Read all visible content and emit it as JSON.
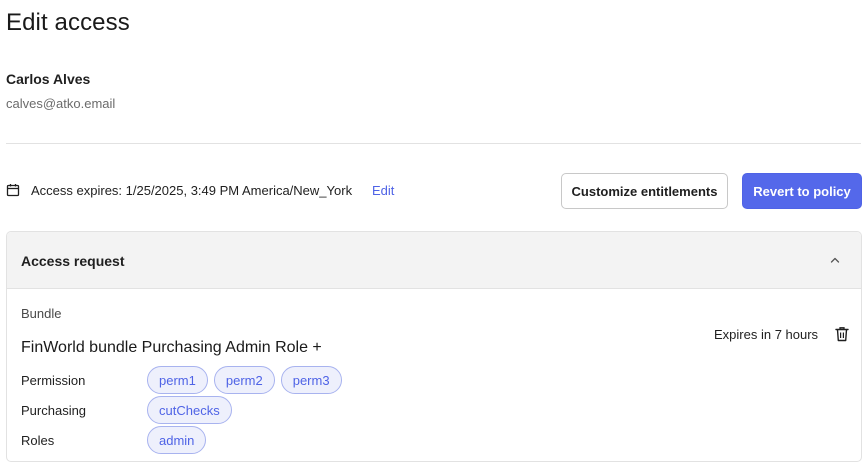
{
  "page": {
    "title": "Edit access"
  },
  "user": {
    "name": "Carlos Alves",
    "email": "calves@atko.email"
  },
  "access": {
    "expires_text": "Access expires: 1/25/2025, 3:49 PM America/New_York",
    "edit_label": "Edit"
  },
  "actions": {
    "customize_label": "Customize entitlements",
    "revert_label": "Revert to policy"
  },
  "request": {
    "title": "Access request",
    "section_label": "Bundle",
    "bundle_name": "FinWorld bundle Purchasing Admin Role +",
    "expires_label": "Expires in 7 hours",
    "rows": [
      {
        "label": "Permission",
        "tags": [
          "perm1",
          "perm2",
          "perm3"
        ]
      },
      {
        "label": "Purchasing",
        "tags": [
          "cutChecks"
        ]
      },
      {
        "label": "Roles",
        "tags": [
          "admin"
        ]
      }
    ]
  },
  "colors": {
    "accent": "#5468ea",
    "tag_bg": "#eef0fc",
    "tag_border": "#a8b3ef",
    "header_bg": "#f3f3f3"
  },
  "icons": [
    "calendar-icon",
    "chevron-up-icon",
    "trash-icon"
  ]
}
